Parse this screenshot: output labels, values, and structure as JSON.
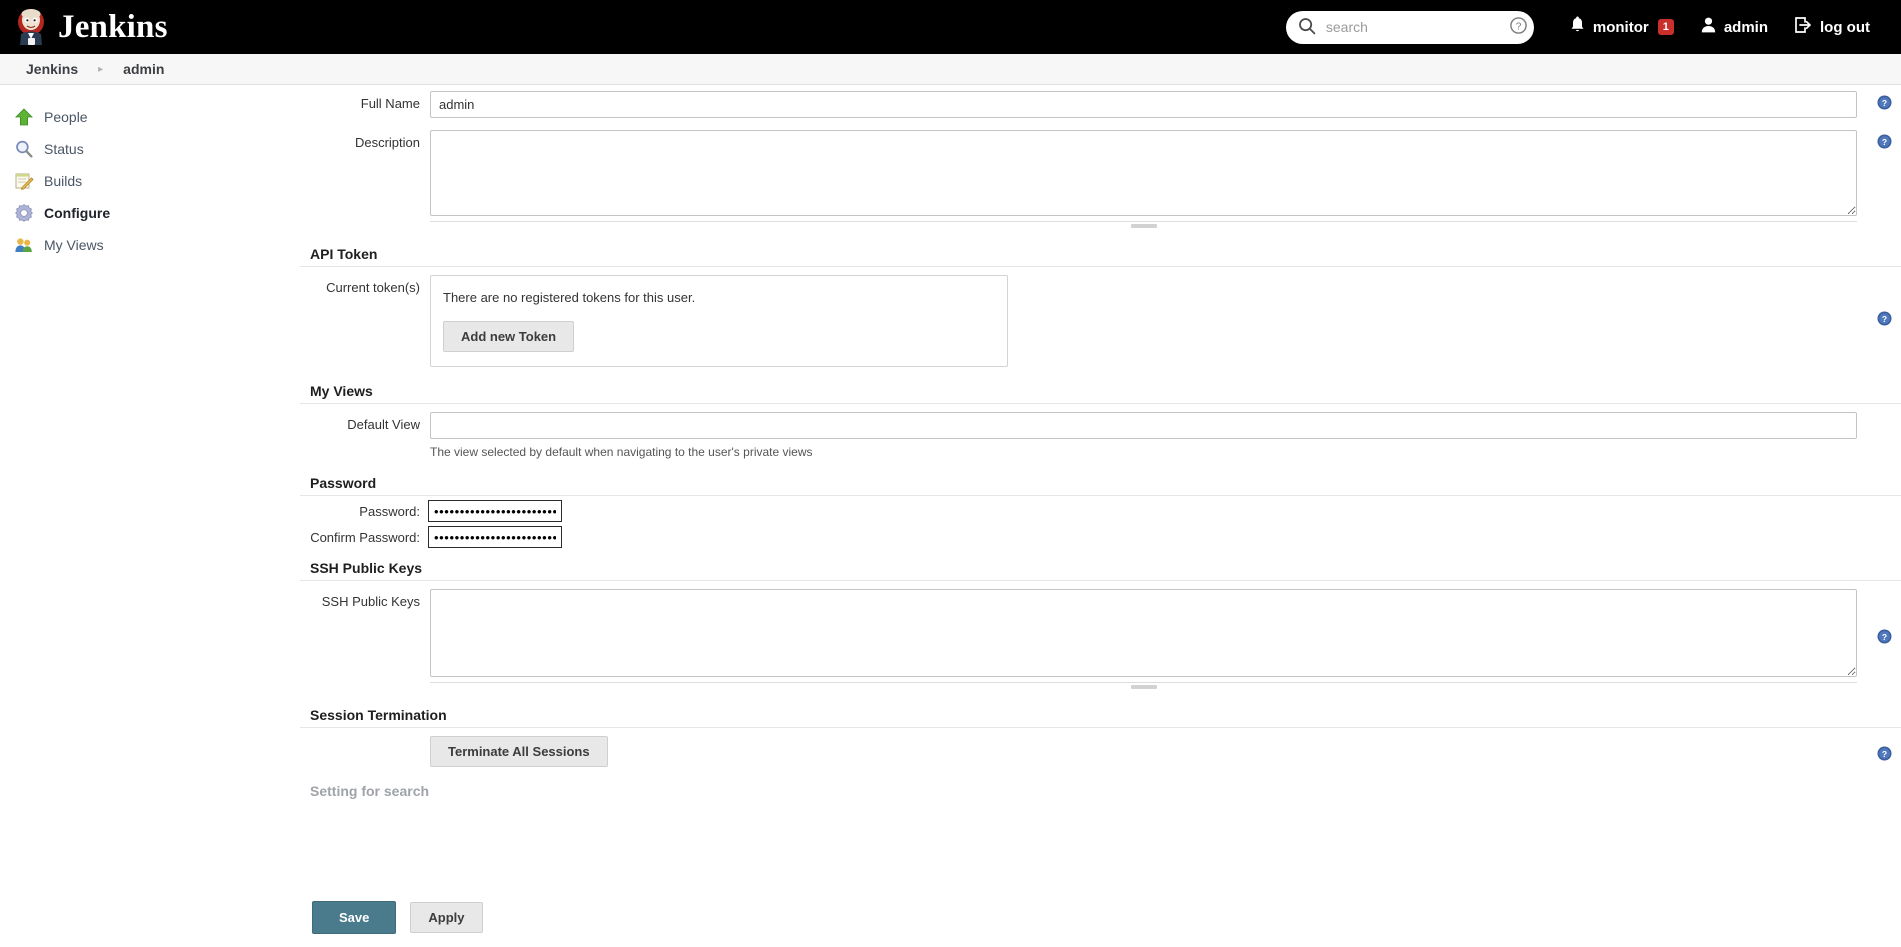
{
  "header": {
    "brand": "Jenkins",
    "logo_icon": "jenkins-butler-logo",
    "search": {
      "icon": "search-icon",
      "placeholder": "search",
      "value": "",
      "help_icon": "question-circle-icon"
    },
    "monitor": {
      "icon": "bell-icon",
      "label": "monitor",
      "badge": "1",
      "badge_color": "#c9302c"
    },
    "user": {
      "icon": "person-icon",
      "label": "admin"
    },
    "logout": {
      "icon": "logout-arrow-icon",
      "label": "log out"
    }
  },
  "breadcrumb": {
    "items": [
      {
        "label": "Jenkins"
      },
      {
        "label": "admin"
      }
    ],
    "separator": "▸"
  },
  "sidebar": {
    "items": [
      {
        "label": "People",
        "icon": "green-up-arrow-icon",
        "active": false
      },
      {
        "label": "Status",
        "icon": "magnifier-icon",
        "active": false
      },
      {
        "label": "Builds",
        "icon": "notepad-pencil-icon",
        "active": false
      },
      {
        "label": "Configure",
        "icon": "gear-icon",
        "active": true
      },
      {
        "label": "My Views",
        "icon": "people-group-icon",
        "active": false
      }
    ]
  },
  "form": {
    "full_name": {
      "label": "Full Name",
      "value": "admin"
    },
    "description": {
      "label": "Description",
      "value": "",
      "placeholder": ""
    },
    "api_token": {
      "section": "API Token",
      "label": "Current token(s)",
      "message": "There are no registered tokens for this user.",
      "add_button": "Add new Token"
    },
    "my_views": {
      "section": "My Views",
      "label": "Default View",
      "value": "",
      "help_text": "The view selected by default when navigating to the user's private views"
    },
    "password": {
      "section": "Password",
      "password_label": "Password:",
      "password_value": "••••••••••••••••••••••••••••",
      "confirm_label": "Confirm Password:",
      "confirm_value": "••••••••••••••••••••••••••••"
    },
    "ssh_keys": {
      "section": "SSH Public Keys",
      "label": "SSH Public Keys",
      "value": ""
    },
    "session_termination": {
      "section": "Session Termination",
      "button": "Terminate All Sessions"
    },
    "search_setting": {
      "section": "Setting for search"
    }
  },
  "footer": {
    "save_label": "Save",
    "apply_label": "Apply",
    "save_color": "#4a7b8c"
  }
}
